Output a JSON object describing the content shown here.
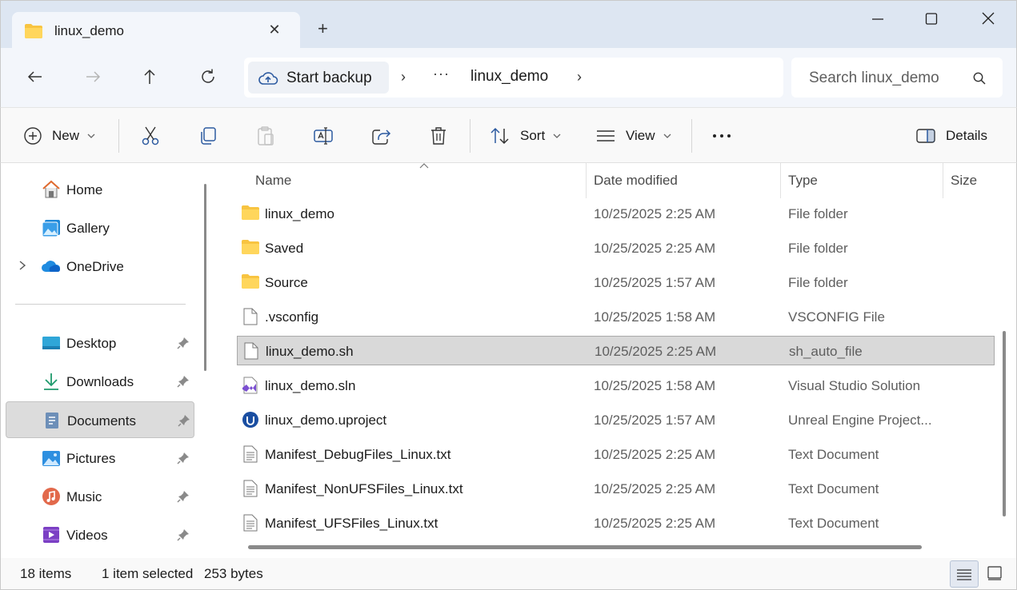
{
  "tab": {
    "title": "linux_demo",
    "close_glyph": "✕"
  },
  "new_tab_glyph": "+",
  "window_controls": {
    "minimize": "—",
    "maximize": "☐",
    "close": "✕"
  },
  "nav": {
    "backup_label": "Start backup",
    "separator": "›",
    "overflow": "···",
    "crumb": "linux_demo"
  },
  "search": {
    "placeholder": "Search linux_demo"
  },
  "commands": {
    "new": "New",
    "sort": "Sort",
    "view": "View",
    "more": "···",
    "details": "Details"
  },
  "sidebar": {
    "items": [
      {
        "label": "Home",
        "icon": "home-icon"
      },
      {
        "label": "Gallery",
        "icon": "gallery-icon"
      },
      {
        "label": "OneDrive",
        "icon": "onedrive-icon"
      },
      {
        "label": "Desktop",
        "icon": "desktop-icon"
      },
      {
        "label": "Downloads",
        "icon": "downloads-icon"
      },
      {
        "label": "Documents",
        "icon": "documents-icon",
        "selected": true
      },
      {
        "label": "Pictures",
        "icon": "pictures-icon"
      },
      {
        "label": "Music",
        "icon": "music-icon"
      },
      {
        "label": "Videos",
        "icon": "videos-icon"
      }
    ]
  },
  "columns": {
    "name": "Name",
    "date": "Date modified",
    "type": "Type",
    "size": "Size"
  },
  "files": [
    {
      "name": "linux_demo",
      "date": "10/25/2025 2:25 AM",
      "type": "File folder",
      "icon": "folder-icon"
    },
    {
      "name": "Saved",
      "date": "10/25/2025 2:25 AM",
      "type": "File folder",
      "icon": "folder-icon"
    },
    {
      "name": "Source",
      "date": "10/25/2025 1:57 AM",
      "type": "File folder",
      "icon": "folder-icon"
    },
    {
      "name": ".vsconfig",
      "date": "10/25/2025 1:58 AM",
      "type": "VSCONFIG File",
      "icon": "file-icon"
    },
    {
      "name": "linux_demo.sh",
      "date": "10/25/2025 2:25 AM",
      "type": "sh_auto_file",
      "icon": "file-icon",
      "selected": true
    },
    {
      "name": "linux_demo.sln",
      "date": "10/25/2025 1:58 AM",
      "type": "Visual Studio Solution",
      "icon": "visual-studio-icon"
    },
    {
      "name": "linux_demo.uproject",
      "date": "10/25/2025 1:57 AM",
      "type": "Unreal Engine Project...",
      "icon": "unreal-engine-icon"
    },
    {
      "name": "Manifest_DebugFiles_Linux.txt",
      "date": "10/25/2025 2:25 AM",
      "type": "Text Document",
      "icon": "text-document-icon"
    },
    {
      "name": "Manifest_NonUFSFiles_Linux.txt",
      "date": "10/25/2025 2:25 AM",
      "type": "Text Document",
      "icon": "text-document-icon"
    },
    {
      "name": "Manifest_UFSFiles_Linux.txt",
      "date": "10/25/2025 2:25 AM",
      "type": "Text Document",
      "icon": "text-document-icon"
    }
  ],
  "status": {
    "item_count": "18 items",
    "selection": "1 item selected",
    "size": "253 bytes"
  },
  "colors": {
    "accent": "#0067c0",
    "folder": "#f8c441",
    "selection": "#d9d9d9",
    "titlebar": "#dde6f2"
  }
}
